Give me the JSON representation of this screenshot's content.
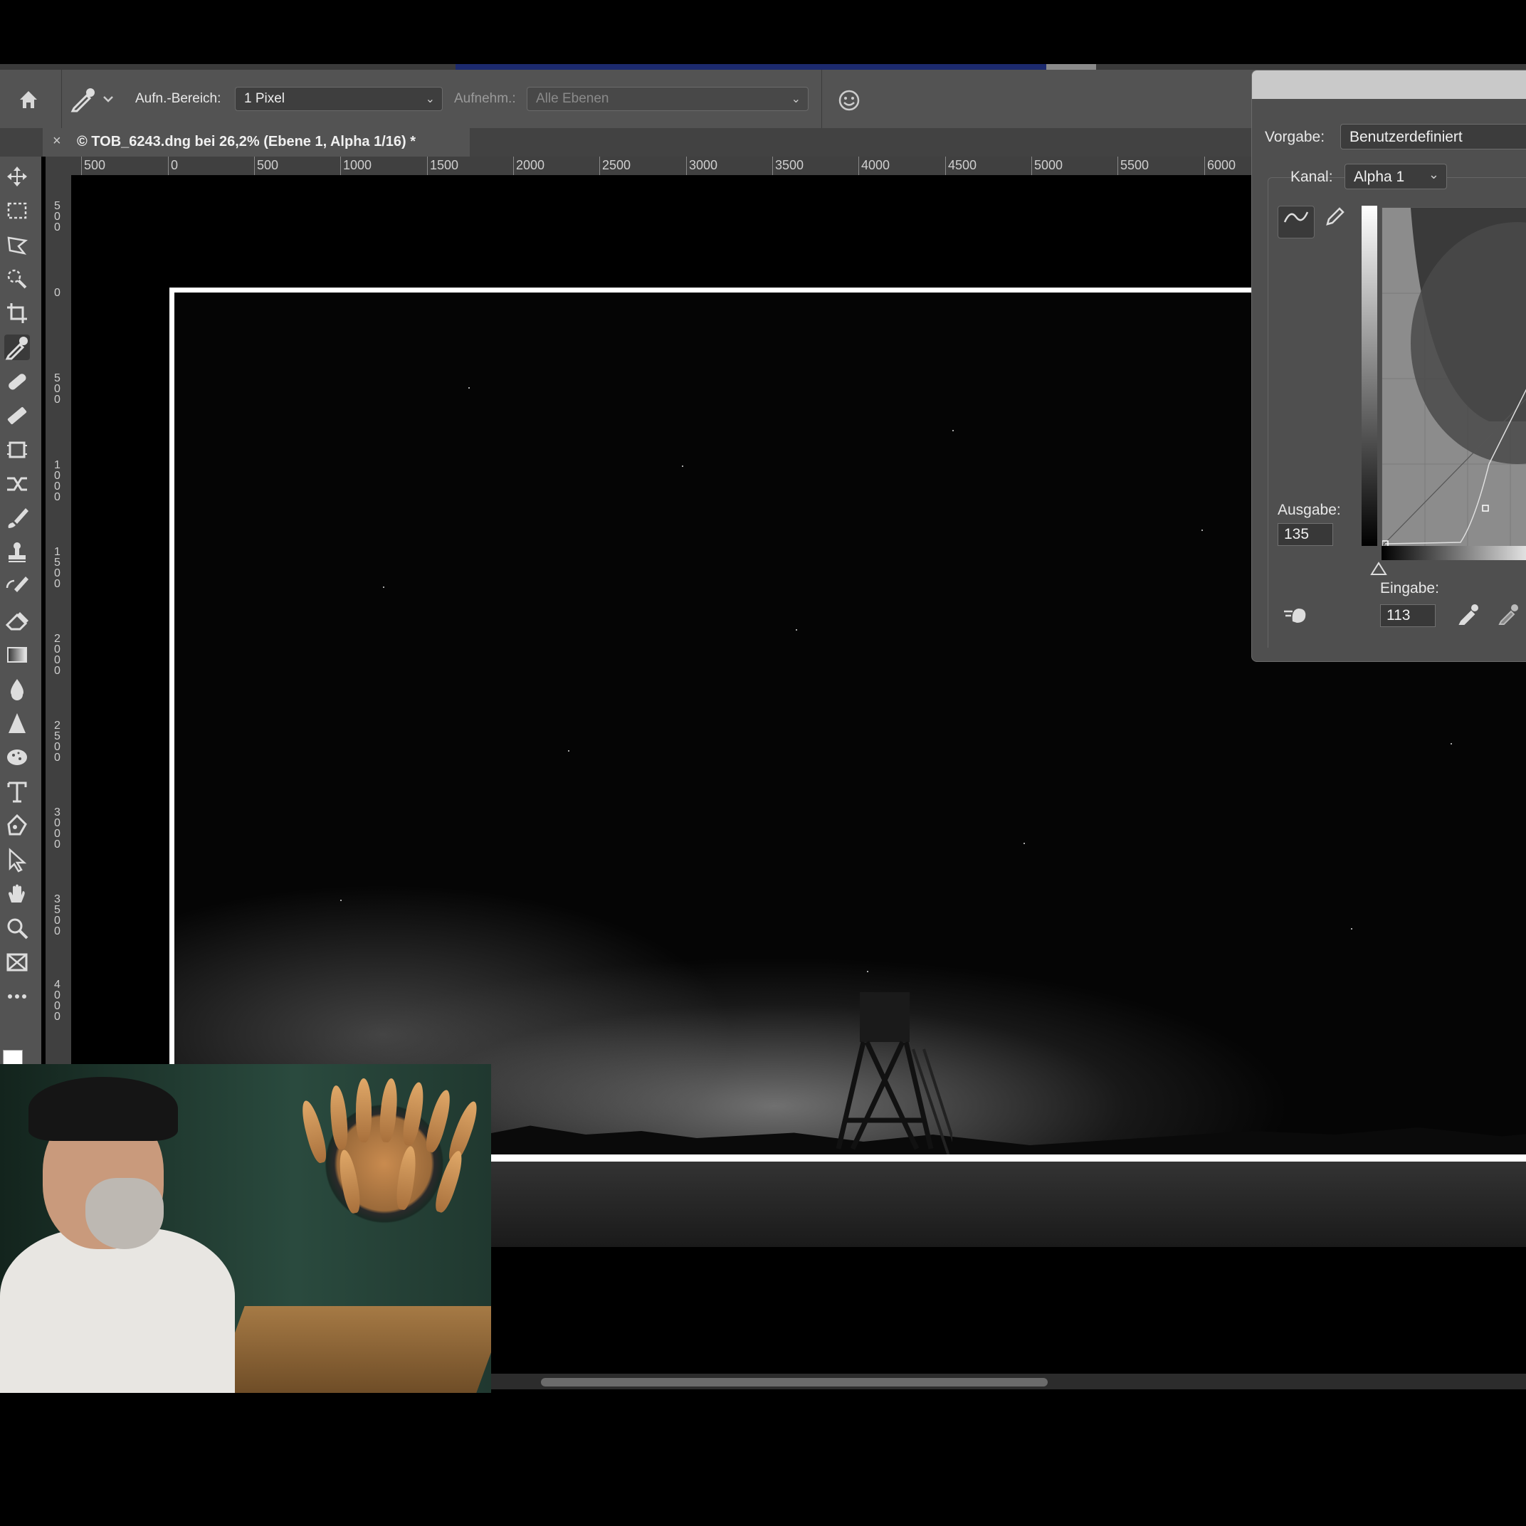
{
  "options_bar": {
    "sample_size_label": "Aufn.-Bereich:",
    "sample_size_value": "1 Pixel",
    "sample_label": "Aufnehm.:",
    "sample_value": "Alle Ebenen"
  },
  "document": {
    "close": "×",
    "tab_title": "© TOB_6243.dng bei 26,2% (Ebene 1, Alpha 1/16) *"
  },
  "ruler": {
    "horizontal": [
      "500",
      "0",
      "500",
      "1000",
      "1500",
      "2000",
      "2500",
      "3000",
      "3500",
      "4000",
      "4500",
      "5000",
      "5500",
      "6000"
    ],
    "vertical": [
      "500",
      "0",
      "500",
      "1000",
      "1500",
      "2000",
      "2500",
      "3000",
      "3500",
      "4000"
    ]
  },
  "curves_dialog": {
    "preset_label": "Vorgabe:",
    "preset_value": "Benutzerdefiniert",
    "channel_label": "Kanal:",
    "channel_value": "Alpha 1",
    "output_label": "Ausgabe:",
    "output_value": "135",
    "input_label": "Eingabe:",
    "input_value": "113"
  },
  "colors": {
    "panel": "#535353",
    "canvas": "#000000",
    "dialog": "#4f4f4f"
  },
  "icons": [
    "home-icon",
    "eyedropper-icon",
    "smiley-icon",
    "move-icon",
    "marquee-icon",
    "lasso-icon",
    "quick-select-icon",
    "crop-icon",
    "eyedropper-tool-icon",
    "healing-icon",
    "patch-icon",
    "transform-icon",
    "content-aware-icon",
    "brush-icon",
    "stamp-icon",
    "history-brush-icon",
    "eraser-icon",
    "gradient-icon",
    "blur-icon",
    "sharpen-icon",
    "sponge-icon",
    "type-icon",
    "pen-icon",
    "path-select-icon",
    "hand-icon",
    "zoom-icon",
    "frame-icon",
    "more-icon",
    "curve-point-icon",
    "pencil-icon",
    "hand-adjust-icon"
  ]
}
